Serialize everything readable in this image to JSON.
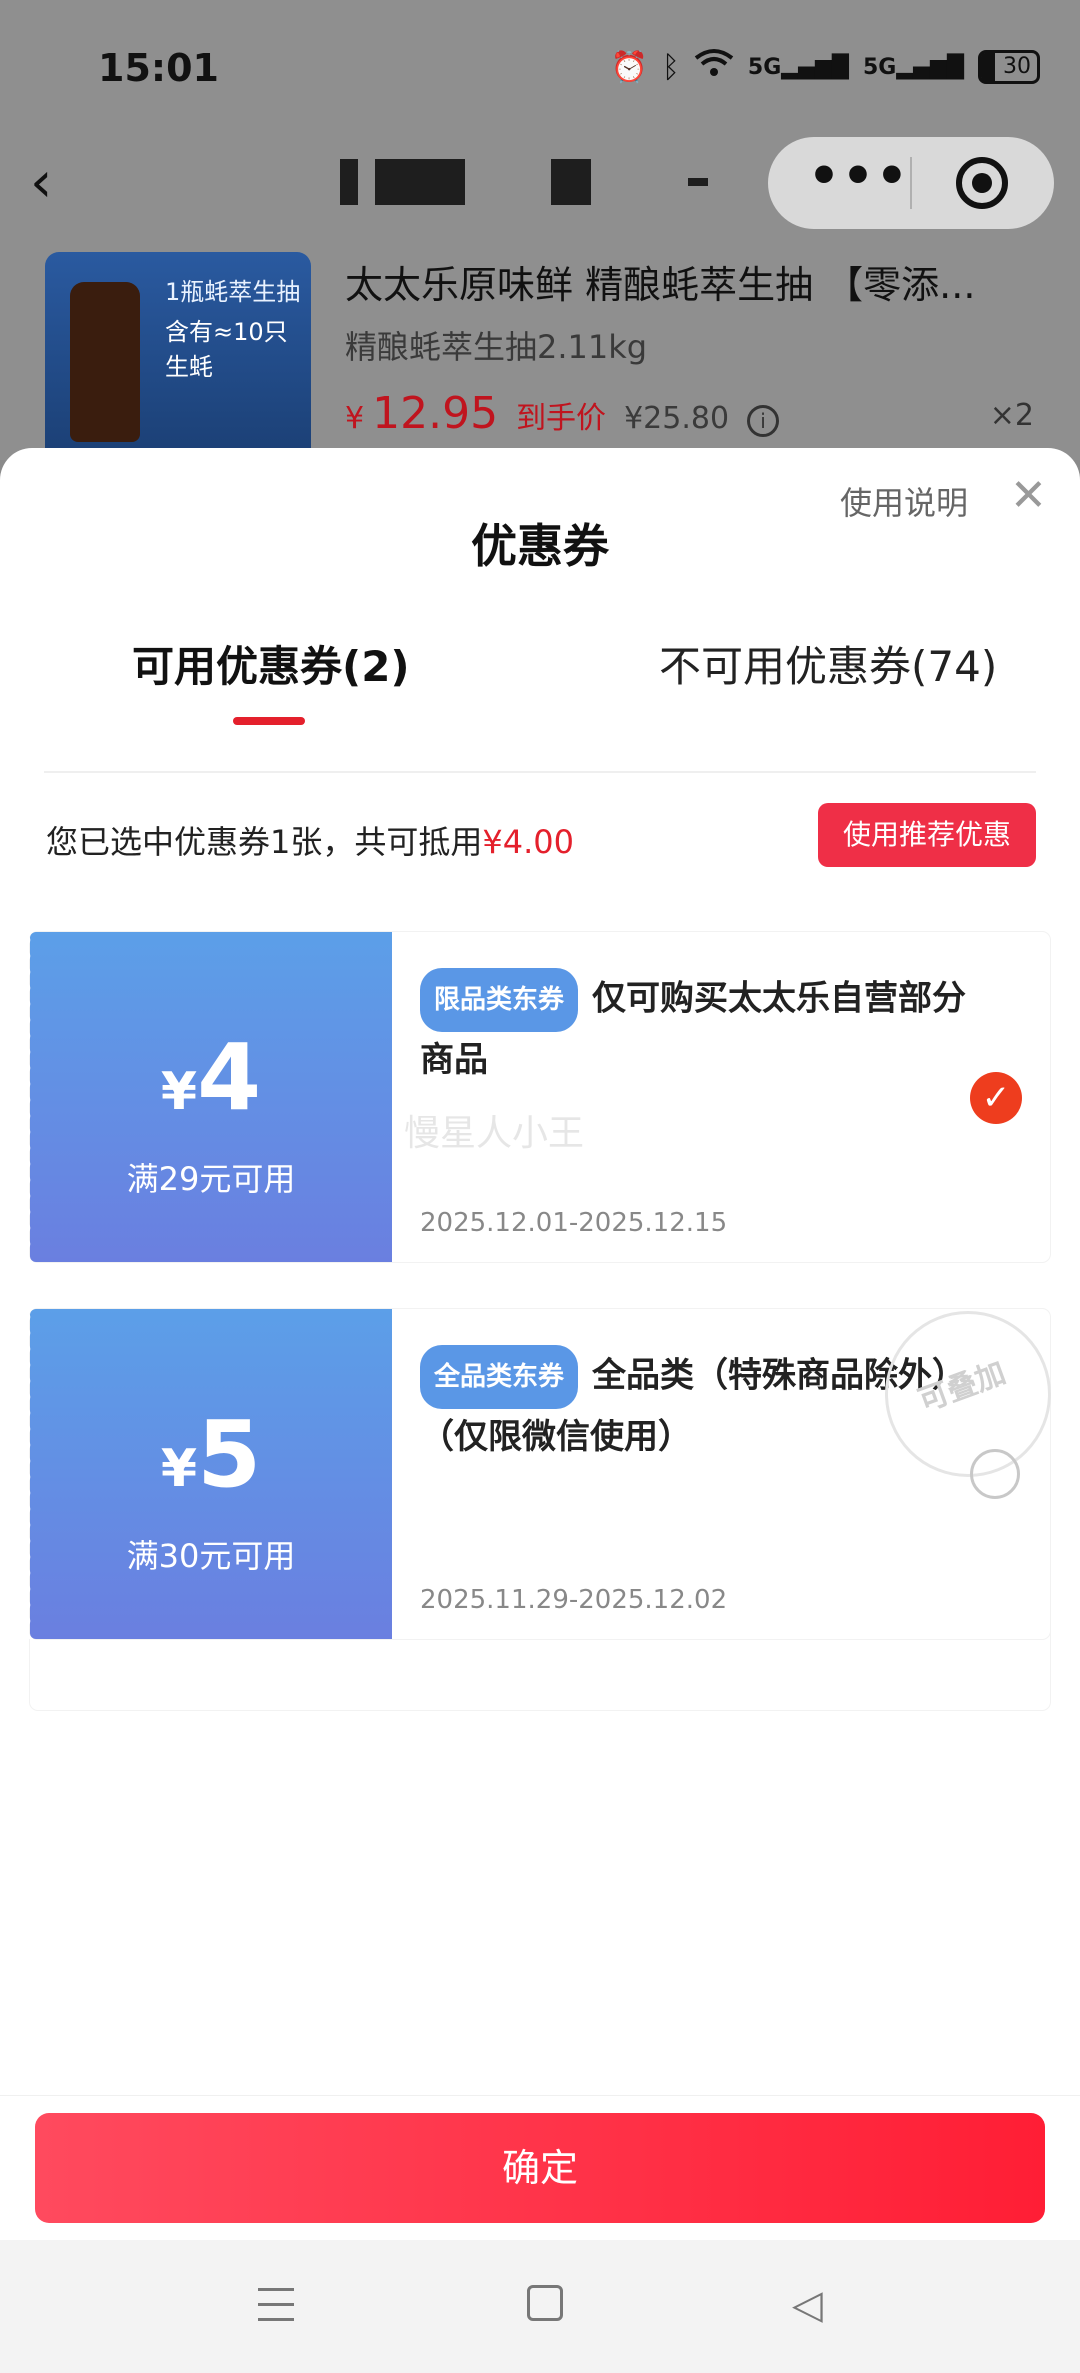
{
  "status_bar": {
    "time": "15:01",
    "battery": "30"
  },
  "product": {
    "name": "太太乐原味鲜 精酿蚝萃生抽 【零添...",
    "spec": "精酿蚝萃生抽2.11kg",
    "price_currency": "¥",
    "price_main": "12.95",
    "price_label": "到手价",
    "original_price": "¥25.80",
    "quantity": "×2",
    "image_text_1": "1瓶蚝萃生抽",
    "image_text_2": "含有≈10只生蚝"
  },
  "sheet": {
    "title": "优惠券",
    "help_link": "使用说明",
    "close": "✕",
    "tabs": [
      {
        "label": "可用优惠券(2)"
      },
      {
        "label": "不可用优惠券(74)"
      }
    ],
    "summary_prefix": "您已选中优惠券1张，共可抵用",
    "summary_amount": "¥4.00",
    "recommend_button": "使用推荐优惠"
  },
  "coupons": [
    {
      "currency": "¥",
      "amount": "4",
      "condition": "满29元可用",
      "badge": "限品类东券",
      "description": "仅可购买太太乐自营部分商品",
      "date": "2025.12.01-2025.12.15",
      "selected": true
    },
    {
      "currency": "¥",
      "amount": "5",
      "condition": "满30元可用",
      "badge": "全品类东券",
      "description": "全品类（特殊商品除外）（仅限微信使用）",
      "date": "2025.11.29-2025.12.02",
      "selected": false,
      "stamp": "可叠加"
    }
  ],
  "watermark": "慢星人小王",
  "confirm_button": "确定",
  "colors": {
    "accent": "#e4202c",
    "coupon_blue": "#5c9fe8",
    "confirm": "#ff1e35"
  }
}
